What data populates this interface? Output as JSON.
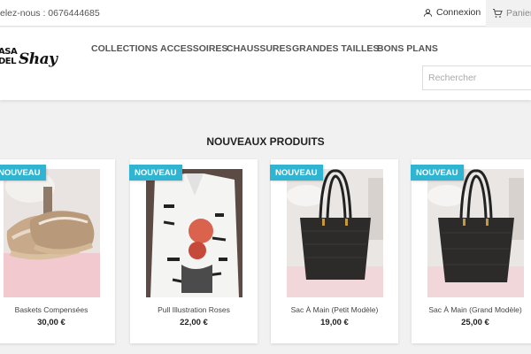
{
  "topbar": {
    "phone_text": "elez-nous : 0676444685",
    "login_label": "Connexion",
    "cart_label": "Panier"
  },
  "header": {
    "logo_line1": "ASA",
    "logo_line2": "DEL",
    "logo_script": "Shay",
    "nav": [
      {
        "label": "COLLECTIONS"
      },
      {
        "label": "ACCESSOIRES"
      },
      {
        "label": "CHAUSSURES"
      },
      {
        "label": "GRANDES TAILLES"
      },
      {
        "label": "BONS PLANS"
      }
    ],
    "search_placeholder": "Rechercher"
  },
  "main": {
    "section_title": "NOUVEAUX PRODUITS",
    "products": [
      {
        "badge": "NOUVEAU",
        "name": "Baskets Compensées",
        "price": "30,00 €"
      },
      {
        "badge": "NOUVEAU",
        "name": "Pull Illustration Roses",
        "price": "22,00 €"
      },
      {
        "badge": "NOUVEAU",
        "name": "Sac À Main (Petit Modèle)",
        "price": "19,00 €"
      },
      {
        "badge": "NOUVEAU",
        "name": "Sac À Main (Grand Modèle)",
        "price": "25,00 €"
      }
    ]
  },
  "colors": {
    "badge": "#2fb5d2",
    "background": "#f1f1f1"
  }
}
